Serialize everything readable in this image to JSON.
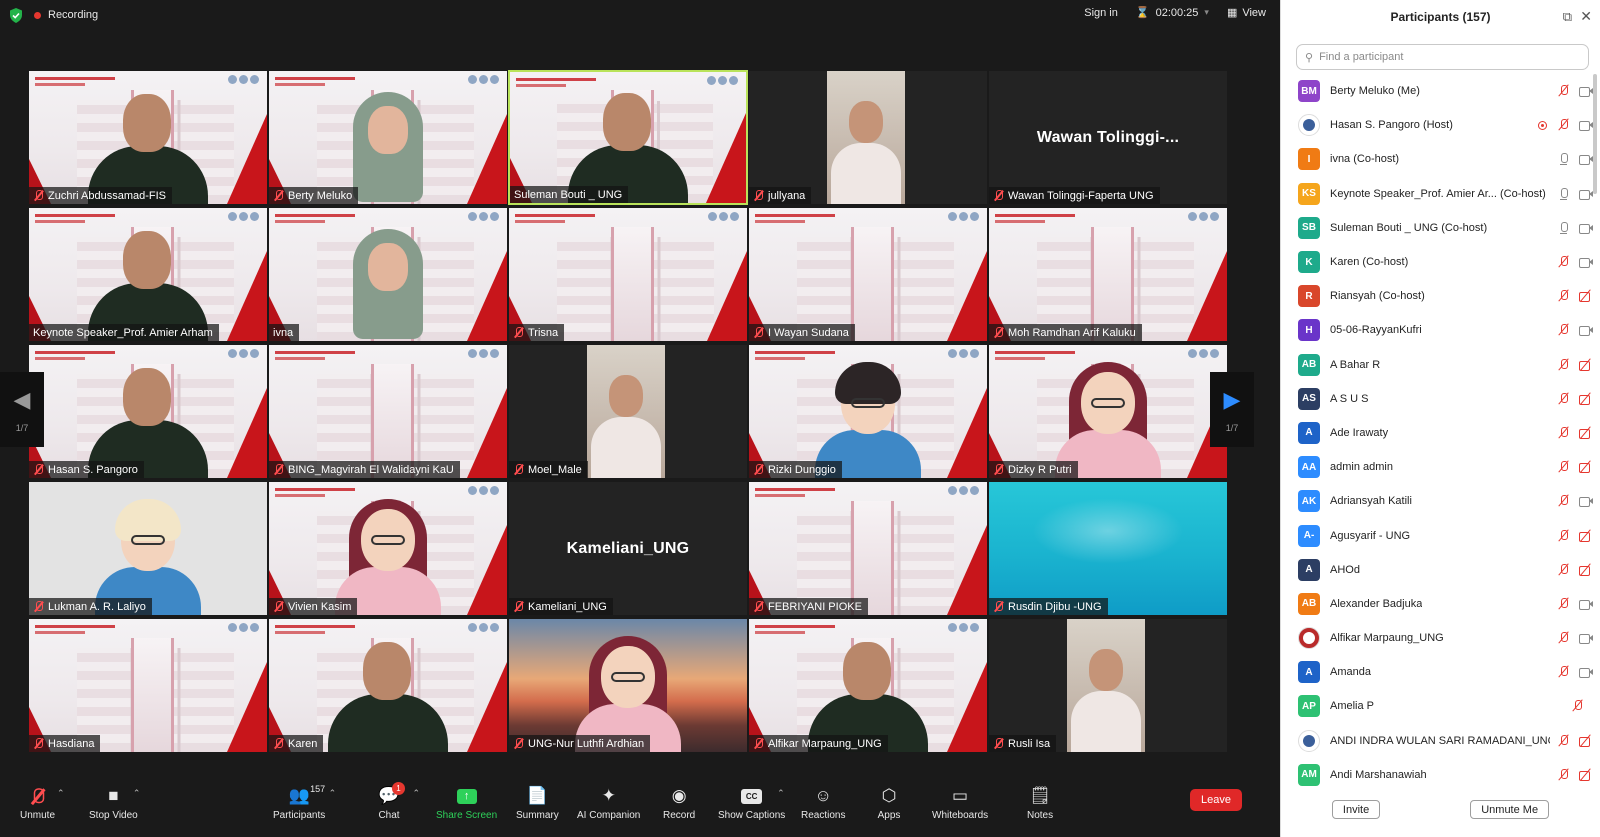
{
  "topbar": {
    "recording_label": "Recording",
    "signin_label": "Sign in",
    "timer": "02:00:25",
    "view_label": "View"
  },
  "tiles": [
    {
      "name": "Zuchri Abdussamad-FIS",
      "bg": "slide",
      "muted": true,
      "figure": "man"
    },
    {
      "name": "Berty Meluko",
      "bg": "slide",
      "muted": true,
      "figure": "hijab"
    },
    {
      "name": "Suleman Bouti _ UNG",
      "bg": "slide",
      "muted": false,
      "figure": "man",
      "speaking": true
    },
    {
      "name": "jullyana",
      "bg": "black",
      "muted": true,
      "figure": "inset"
    },
    {
      "name": "Wawan Tolinggi-Faperta UNG",
      "bg": "black",
      "muted": true,
      "bigname": "Wawan Tolinggi-..."
    },
    {
      "name": "Keynote Speaker_Prof. Amier Arham",
      "bg": "slide",
      "muted": false,
      "figure": "man"
    },
    {
      "name": "ivna",
      "bg": "slide",
      "muted": false,
      "figure": "hijab"
    },
    {
      "name": "Trisna",
      "bg": "slide",
      "muted": true
    },
    {
      "name": "I Wayan Sudana",
      "bg": "slide",
      "muted": true
    },
    {
      "name": "Moh Ramdhan Arif Kaluku",
      "bg": "slide",
      "muted": true
    },
    {
      "name": "Hasan S. Pangoro",
      "bg": "slide",
      "muted": true,
      "figure": "man"
    },
    {
      "name": "BING_Magvirah El Walidayni KaU",
      "bg": "slide",
      "muted": true
    },
    {
      "name": "Moel_Male",
      "bg": "black",
      "muted": true,
      "figure": "inset"
    },
    {
      "name": "Rizki Dunggio",
      "bg": "slide",
      "muted": true,
      "figure": "avatar-boy"
    },
    {
      "name": "Dizky R Putri",
      "bg": "slide",
      "muted": true,
      "figure": "avatar-hijab"
    },
    {
      "name": "Lukman A. R. Laliyo",
      "bg": "grey",
      "muted": true,
      "figure": "avatar-blond"
    },
    {
      "name": "Vivien Kasim",
      "bg": "slide",
      "muted": true,
      "figure": "avatar-hijab"
    },
    {
      "name": "Kameliani_UNG",
      "bg": "black",
      "muted": true,
      "bigname": "Kameliani_UNG"
    },
    {
      "name": "FEBRIYANI PIOKE",
      "bg": "slide",
      "muted": true
    },
    {
      "name": "Rusdin Djibu -UNG",
      "bg": "cyan",
      "muted": true
    },
    {
      "name": "Hasdiana",
      "bg": "slide",
      "muted": true
    },
    {
      "name": "Karen",
      "bg": "slide",
      "muted": true,
      "figure": "man"
    },
    {
      "name": "UNG-Nur Luthfi Ardhian",
      "bg": "sunset",
      "muted": true,
      "figure": "avatar-hijab"
    },
    {
      "name": "Alfikar Marpaung_UNG",
      "bg": "slide",
      "muted": true,
      "figure": "man"
    },
    {
      "name": "Rusli Isa",
      "bg": "black",
      "muted": true,
      "figure": "inset"
    }
  ],
  "pager": {
    "left_label": "1/7",
    "right_label": "1/7"
  },
  "toolbar": {
    "unmute": "Unmute",
    "stop_video": "Stop Video",
    "participants": "Participants",
    "participants_count": "157",
    "chat": "Chat",
    "chat_badge": "1",
    "share_screen": "Share Screen",
    "summary": "Summary",
    "ai_companion": "AI Companion",
    "record": "Record",
    "show_captions": "Show Captions",
    "cc": "CC",
    "reactions": "Reactions",
    "apps": "Apps",
    "whiteboards": "Whiteboards",
    "notes": "Notes",
    "leave": "Leave"
  },
  "panel": {
    "title": "Participants (157)",
    "search_placeholder": "Find a participant",
    "invite": "Invite",
    "unmute_me": "Unmute Me",
    "participants": [
      {
        "initials": "BM",
        "color": "#8e44c9",
        "name": "Berty Meluko (Me)",
        "mic": "red",
        "cam": "gray"
      },
      {
        "initials": "",
        "color": "#ffffff",
        "name": "Hasan S. Pangoro (Host)",
        "mic": "red",
        "cam": "gray",
        "rec": true,
        "logo": true
      },
      {
        "initials": "I",
        "color": "#f07b14",
        "name": "ivna (Co-host)",
        "mic": "gray",
        "cam": "gray"
      },
      {
        "initials": "KS",
        "color": "#f5a51c",
        "name": "Keynote Speaker_Prof. Amier Ar... (Co-host)",
        "mic": "gray",
        "cam": "gray"
      },
      {
        "initials": "SB",
        "color": "#1eaa8b",
        "name": "Suleman Bouti _ UNG (Co-host)",
        "mic": "gray",
        "cam": "gray"
      },
      {
        "initials": "K",
        "color": "#1eaa8b",
        "name": "Karen (Co-host)",
        "mic": "red",
        "cam": "gray"
      },
      {
        "initials": "R",
        "color": "#d9472b",
        "name": "Riansyah (Co-host)",
        "mic": "red",
        "cam": "red"
      },
      {
        "initials": "H",
        "color": "#6a35c9",
        "name": "05-06-RayyanKufri",
        "mic": "red",
        "cam": "gray"
      },
      {
        "initials": "AB",
        "color": "#1eaa8b",
        "name": "A Bahar R",
        "mic": "red",
        "cam": "red"
      },
      {
        "initials": "AS",
        "color": "#2c3e63",
        "name": "A S U S",
        "mic": "red",
        "cam": "red"
      },
      {
        "initials": "A",
        "color": "#1e63c8",
        "name": "Ade Irawaty",
        "mic": "red",
        "cam": "red"
      },
      {
        "initials": "AA",
        "color": "#2d8cff",
        "name": "admin admin",
        "mic": "red",
        "cam": "red"
      },
      {
        "initials": "AK",
        "color": "#2d8cff",
        "name": "Adriansyah Katili",
        "mic": "red",
        "cam": "gray"
      },
      {
        "initials": "A-",
        "color": "#2d8cff",
        "name": "Agusyarif - UNG",
        "mic": "red",
        "cam": "red"
      },
      {
        "initials": "A",
        "color": "#2c3e63",
        "name": "AHOd",
        "mic": "red",
        "cam": "red"
      },
      {
        "initials": "AB",
        "color": "#f07b14",
        "name": "Alexander Badjuka",
        "mic": "red",
        "cam": "gray"
      },
      {
        "initials": "",
        "color": "#b92b2b",
        "name": "Alfikar Marpaung_UNG",
        "mic": "red",
        "cam": "gray",
        "logo": true
      },
      {
        "initials": "A",
        "color": "#1e63c8",
        "name": "Amanda",
        "mic": "red",
        "cam": "gray"
      },
      {
        "initials": "AP",
        "color": "#2ec173",
        "name": "Amelia P",
        "mic": "red",
        "cam": "none"
      },
      {
        "initials": "",
        "color": "#ffffff",
        "name": "ANDI INDRA WULAN SARI RAMADANI_UNG",
        "mic": "red",
        "cam": "red",
        "logo": true
      },
      {
        "initials": "AM",
        "color": "#2ec173",
        "name": "Andi Marshanawiah",
        "mic": "red",
        "cam": "red"
      }
    ]
  },
  "colors": {
    "meeting_bg": "#1a1a1a",
    "accent_blue": "#2d8cff",
    "leave_red": "#e02828",
    "speaking_border": "#b9e35a",
    "share_green": "#2ed15a"
  }
}
